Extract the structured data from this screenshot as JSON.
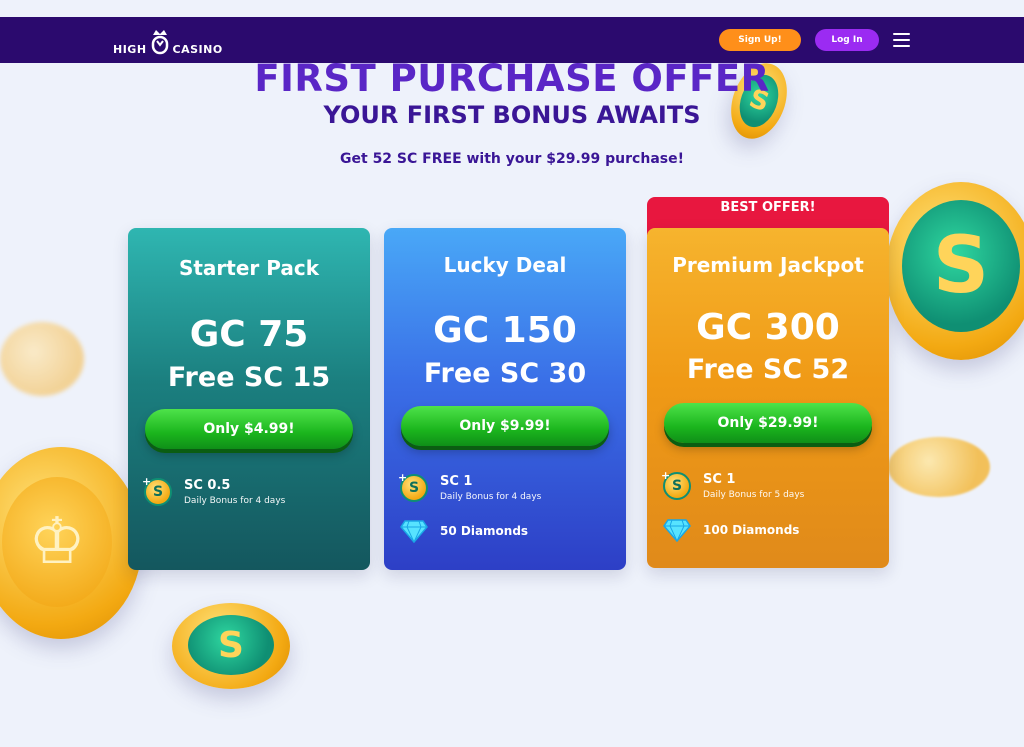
{
  "header": {
    "logo_left": "HIGH",
    "logo_right": "CASINO",
    "signup_label": "Sign Up!",
    "login_label": "Log In"
  },
  "hero": {
    "title": "FIRST PURCHASE OFFER",
    "subtitle": "YOUR FIRST BONUS AWAITS",
    "promo": "Get 52 SC FREE with your $29.99 purchase!"
  },
  "offers": [
    {
      "name": "Starter Pack",
      "gc": "GC 75",
      "sc": "Free SC 15",
      "button": "Only $4.99!",
      "perk_title": "SC 0.5",
      "perk_desc": "Daily Bonus for 4 days"
    },
    {
      "name": "Lucky Deal",
      "gc": "GC 150",
      "sc": "Free SC 30",
      "button": "Only $9.99!",
      "perk_title": "SC 1",
      "perk_desc": "Daily Bonus for 4 days",
      "diamonds": "50 Diamonds"
    },
    {
      "badge": "BEST OFFER!",
      "name": "Premium Jackpot",
      "gc": "GC 300",
      "sc": "Free SC 52",
      "button": "Only $29.99!",
      "perk_title": "SC 1",
      "perk_desc": "Daily Bonus for 5 days",
      "diamonds": "100 Diamonds"
    }
  ],
  "colors": {
    "topbar": "#2b0a6e",
    "signup": "#ff8f1a",
    "login": "#9b2bf2",
    "buy_button": "#1bb51d",
    "best_badge": "#e8173f"
  },
  "icons": [
    "menu-icon",
    "sc-coin-icon",
    "diamond-icon",
    "logo-crown-icon"
  ]
}
